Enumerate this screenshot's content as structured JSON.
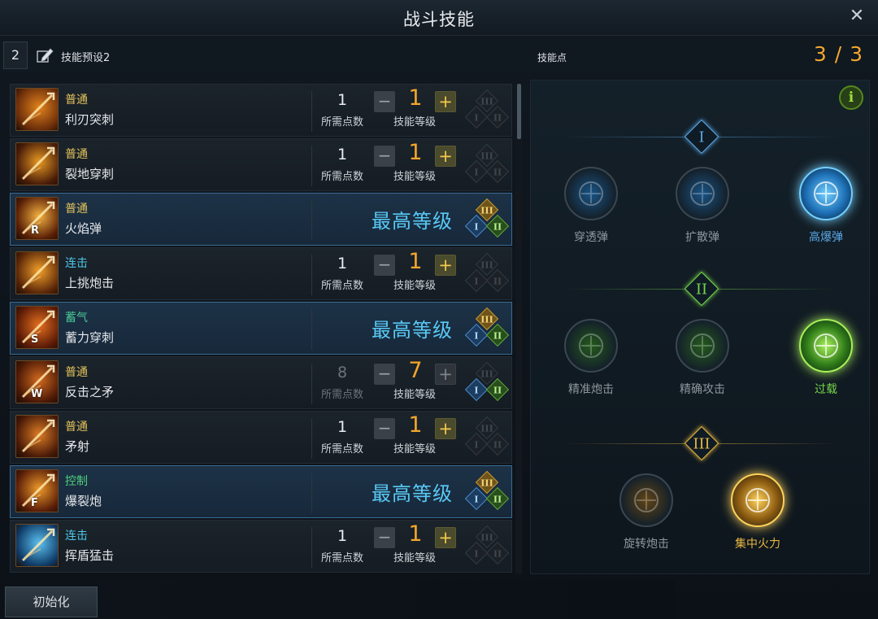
{
  "window": {
    "title": "战斗技能",
    "close_symbol": "✕"
  },
  "preset": {
    "number": "2",
    "name": "技能预设2",
    "edit_icon": "pencil-icon"
  },
  "skill_points": {
    "label": "技能点",
    "value": "3 / 3"
  },
  "labels": {
    "req": "所需点数",
    "lvl": "技能等级",
    "max": "最高等级",
    "minus": "−",
    "plus": "+"
  },
  "skills": [
    {
      "type": "普通",
      "type_color": "#e3c35a",
      "name": "利刃突刺",
      "key": "",
      "req": "1",
      "level": "1",
      "max": false,
      "req_dim": false,
      "plus_dim": false
    },
    {
      "type": "普通",
      "type_color": "#e3c35a",
      "name": "裂地穿刺",
      "key": "",
      "req": "1",
      "level": "1",
      "max": false,
      "req_dim": false,
      "plus_dim": false
    },
    {
      "type": "普通",
      "type_color": "#e3c35a",
      "name": "火焰弹",
      "key": "R",
      "req": "",
      "level": "",
      "max": true
    },
    {
      "type": "连击",
      "type_color": "#4ec7e8",
      "name": "上挑炮击",
      "key": "",
      "req": "1",
      "level": "1",
      "max": false,
      "req_dim": false,
      "plus_dim": false
    },
    {
      "type": "蓄气",
      "type_color": "#49c996",
      "name": "蓄力穿刺",
      "key": "S",
      "req": "",
      "level": "",
      "max": true
    },
    {
      "type": "普通",
      "type_color": "#e3c35a",
      "name": "反击之矛",
      "key": "W",
      "req": "8",
      "level": "7",
      "max": false,
      "req_dim": true,
      "plus_dim": true,
      "tripod_active": true
    },
    {
      "type": "普通",
      "type_color": "#e3c35a",
      "name": "矛射",
      "key": "",
      "req": "1",
      "level": "1",
      "max": false,
      "req_dim": false,
      "plus_dim": false
    },
    {
      "type": "控制",
      "type_color": "#4fd27c",
      "name": "爆裂炮",
      "key": "F",
      "req": "",
      "level": "",
      "max": true
    },
    {
      "type": "连击",
      "type_color": "#4ec7e8",
      "name": "挥盾猛击",
      "key": "",
      "req": "1",
      "level": "1",
      "max": false,
      "req_dim": false,
      "plus_dim": false
    }
  ],
  "tripod": {
    "info_symbol": "i",
    "tiers": [
      {
        "numeral": "I",
        "color": "#5aa8e8",
        "options": [
          {
            "name": "穿透弹",
            "selected": false,
            "icon": "arrow-pierce-icon"
          },
          {
            "name": "扩散弹",
            "selected": false,
            "icon": "skull-icon"
          },
          {
            "name": "高爆弹",
            "selected": true,
            "icon": "horned-skull-icon"
          }
        ]
      },
      {
        "numeral": "II",
        "color": "#76d64a",
        "options": [
          {
            "name": "精准炮击",
            "selected": false,
            "icon": "precise-shot-icon"
          },
          {
            "name": "精确攻击",
            "selected": false,
            "icon": "chevrons-icon"
          },
          {
            "name": "过载",
            "selected": true,
            "icon": "overload-arrow-icon"
          }
        ]
      },
      {
        "numeral": "III",
        "color": "#e6b640",
        "options": [
          {
            "name": "旋转炮击",
            "selected": false,
            "icon": "crossed-arrows-icon"
          },
          {
            "name": "集中火力",
            "selected": true,
            "icon": "burst-icon"
          }
        ]
      }
    ]
  },
  "reset_button": "初始化"
}
